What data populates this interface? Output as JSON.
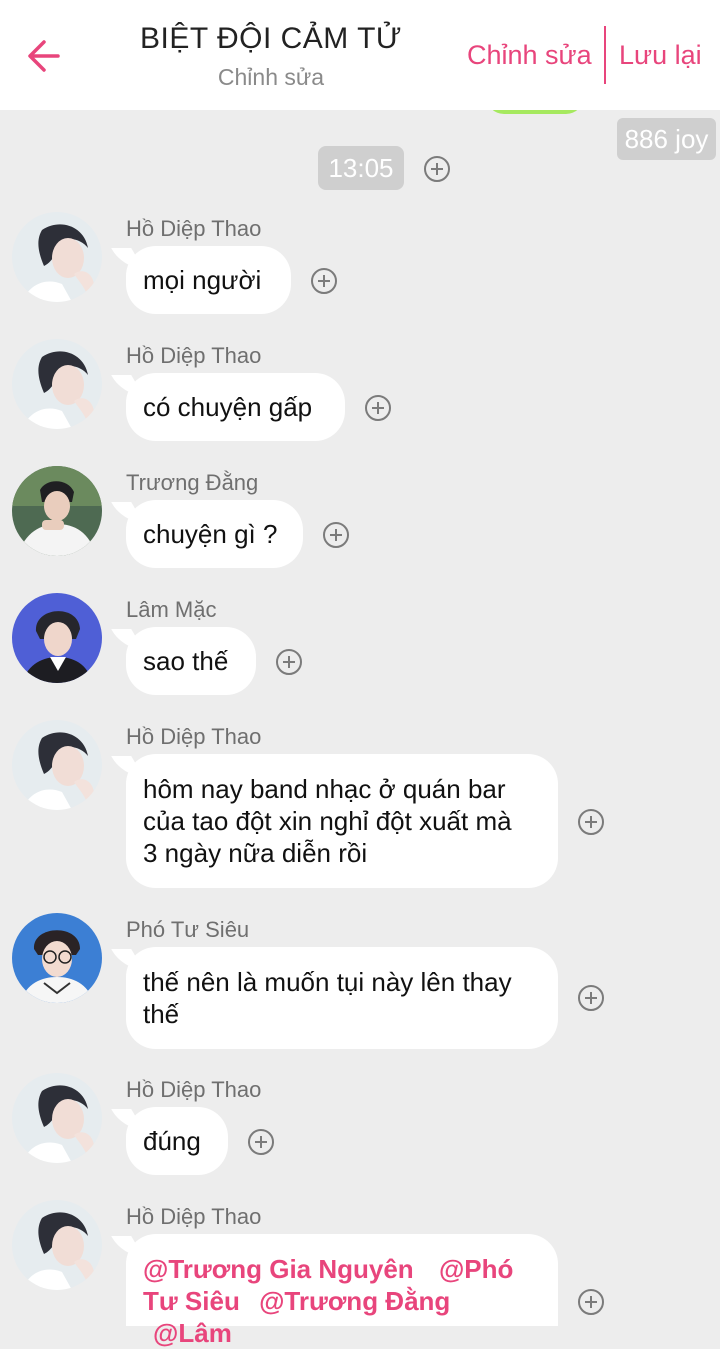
{
  "header": {
    "title": "BIỆT ĐỘI CẢM TỬ",
    "subtitle": "Chỉnh sửa",
    "edit_label": "Chỉnh sửa",
    "save_label": "Lưu lại",
    "accent_color": "#e8457c"
  },
  "badges": {
    "joy": "886 joy",
    "time": "13:05"
  },
  "messages": [
    {
      "sender": "Hồ Diệp Thao",
      "text": "mọi người"
    },
    {
      "sender": "Hồ Diệp Thao",
      "text": "có chuyện gấp"
    },
    {
      "sender": "Trương Đằng",
      "text": "chuyện gì ?"
    },
    {
      "sender": "Lâm Mặc",
      "text": "sao thế"
    },
    {
      "sender": "Hồ Diệp Thao",
      "lines": [
        "hôm nay band nhạc ở quán bar",
        "của tao đột xin nghỉ đột xuất mà",
        "3 ngày nữa diễn rồi"
      ]
    },
    {
      "sender": "Phó Tư Siêu",
      "lines": [
        "thế nên là muốn tụi này lên thay",
        "thế"
      ]
    },
    {
      "sender": "Hồ Diệp Thao",
      "text": "đúng"
    },
    {
      "sender": "Hồ Diệp Thao",
      "mentions": [
        "@Trương Gia Nguyên",
        "@Phó",
        "Tư Siêu",
        "@Trương Đằng",
        "@Lâm"
      ]
    }
  ]
}
